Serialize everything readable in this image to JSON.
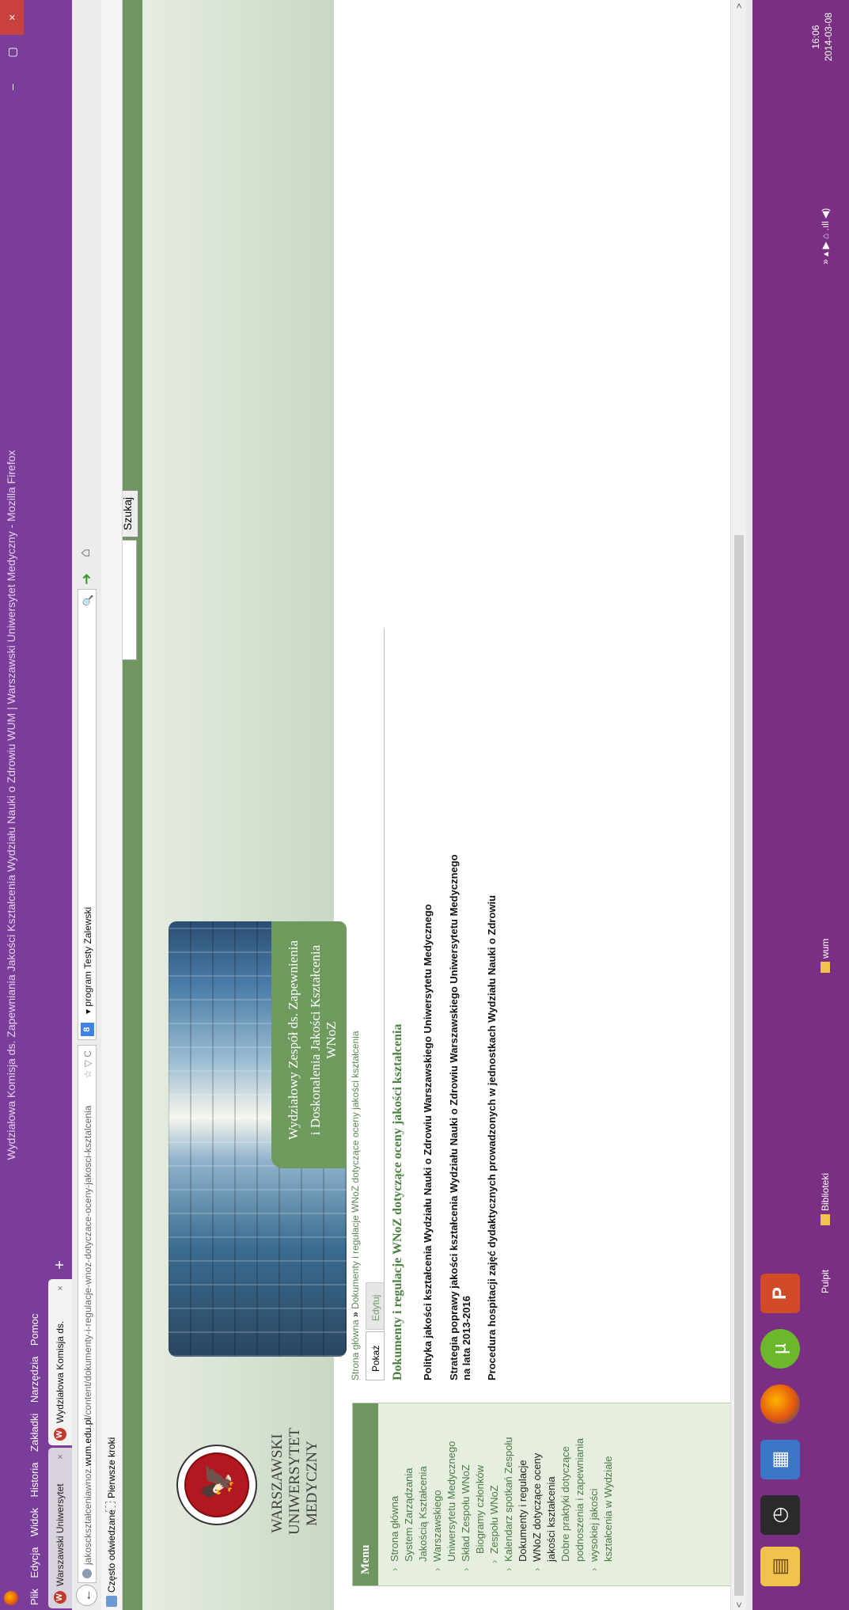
{
  "window": {
    "title": "Wydziałowa Komisja ds. Zapewniania Jakości Kształcenia Wydziału Nauki o Zdrowiu WUM | Warszawski Uniwersytet Medyczny - Mozilla Firefox",
    "min": "–",
    "max": "▢",
    "close": "×"
  },
  "menubar": [
    "Plik",
    "Edycja",
    "Widok",
    "Historia",
    "Zakładki",
    "Narzędzia",
    "Pomoc"
  ],
  "tabs": [
    {
      "label": "Warszawski Uniwersytet Medyczny",
      "close": "×"
    },
    {
      "label": "Wydziałowa Komisja ds. Zapewniania...",
      "close": "×"
    }
  ],
  "new_tab": "+",
  "nav": {
    "back": "←",
    "url_prefix": "jakosckształceniawnoz.",
    "url_domain": "wum.edu.pl",
    "url_path": "/content/dokumenty-i-regulacje-wnoz-dotyczace-oceny-jakosci-ksztalcenia",
    "url_icons": "☆ ▽ C",
    "search_engine_icon": "8",
    "search_text": "▾ program Testy Zalewski",
    "search_icon": "🔍",
    "forward_green": "➜",
    "home_icon": "⌂"
  },
  "bookmarks": [
    "Często odwiedzane",
    "Pierwsze kroki"
  ],
  "site": {
    "search_button": "Szukaj",
    "wum_name": [
      "WARSZAWSKI",
      "UNIWERSYTET",
      "MEDYCZNY"
    ],
    "banner_line1": "Wydziałowy Zespół ds. Zapewnienia",
    "banner_line2": "i Doskonalenia Jakości Kształcenia WNoZ",
    "menu_title": "Menu",
    "menu": [
      {
        "text": "Strona główna",
        "bullet": true,
        "sub": false,
        "active": false
      },
      {
        "text": "System Zarządzania",
        "bullet": false,
        "sub": false,
        "active": false
      },
      {
        "text": "Jakością Kształcenia",
        "bullet": false,
        "sub": false,
        "active": false
      },
      {
        "text": "Warszawskiego",
        "bullet": true,
        "sub": false,
        "active": false
      },
      {
        "text": "Uniwersytetu Medycznego",
        "bullet": false,
        "sub": false,
        "active": false
      },
      {
        "text": "Skład Zespołu WNoZ",
        "bullet": true,
        "sub": false,
        "active": false
      },
      {
        "text": "Biogramy członków",
        "bullet": false,
        "sub": true,
        "active": false
      },
      {
        "text": "Zespołu WNoZ",
        "bullet": true,
        "sub": true,
        "active": false
      },
      {
        "text": "Kalendarz spotkań Zespołu",
        "bullet": true,
        "sub": false,
        "active": false
      },
      {
        "text": "Dokumenty i regulacje",
        "bullet": false,
        "sub": false,
        "active": true
      },
      {
        "text": "WNoZ dotyczące oceny",
        "bullet": true,
        "sub": false,
        "active": true
      },
      {
        "text": "jakości kształcenia",
        "bullet": false,
        "sub": false,
        "active": true
      },
      {
        "text": "Dobre praktyki dotyczące",
        "bullet": false,
        "sub": false,
        "active": false
      },
      {
        "text": "podnoszenia i zapewniania",
        "bullet": false,
        "sub": false,
        "active": false
      },
      {
        "text": "wysokiej jakości",
        "bullet": true,
        "sub": false,
        "active": false
      },
      {
        "text": "kształcenia w Wydziale",
        "bullet": false,
        "sub": false,
        "active": false
      }
    ],
    "breadcrumb_home": "Strona główna",
    "breadcrumb_sep": "»",
    "breadcrumb_current": "Dokumenty i regulacje WNoZ dotyczące oceny jakości kształcenia",
    "tab_show": "Pokaż",
    "tab_edit": "Edytuj",
    "page_title": "Dokumenty i regulacje WNoZ dotyczące oceny jakości kształcenia",
    "docs": [
      "Polityka jakości kształcenia Wydziału Nauki o Zdrowiu Warszawskiego Uniwersytetu Medycznego",
      "Strategia poprawy jakości kształcenia Wydziału Nauki o Zdrowiu Warszawskiego Uniwersytetu Medycznego",
      "na lata 2013-2016",
      "Procedura hospitacji zajęć dydaktycznych prowadzonych w jednostkach Wydziału Nauki o Zdrowiu"
    ]
  },
  "scroll": {
    "left": "<",
    "right": ">"
  },
  "taskbar": {
    "pulpit": "Pulpit",
    "biblioteki": "Biblioteki",
    "wum": "wum",
    "tray": "»   ▴  ▶  ⌂  .ıll  ◀)",
    "time": "16:06",
    "date": "2014-03-08"
  }
}
